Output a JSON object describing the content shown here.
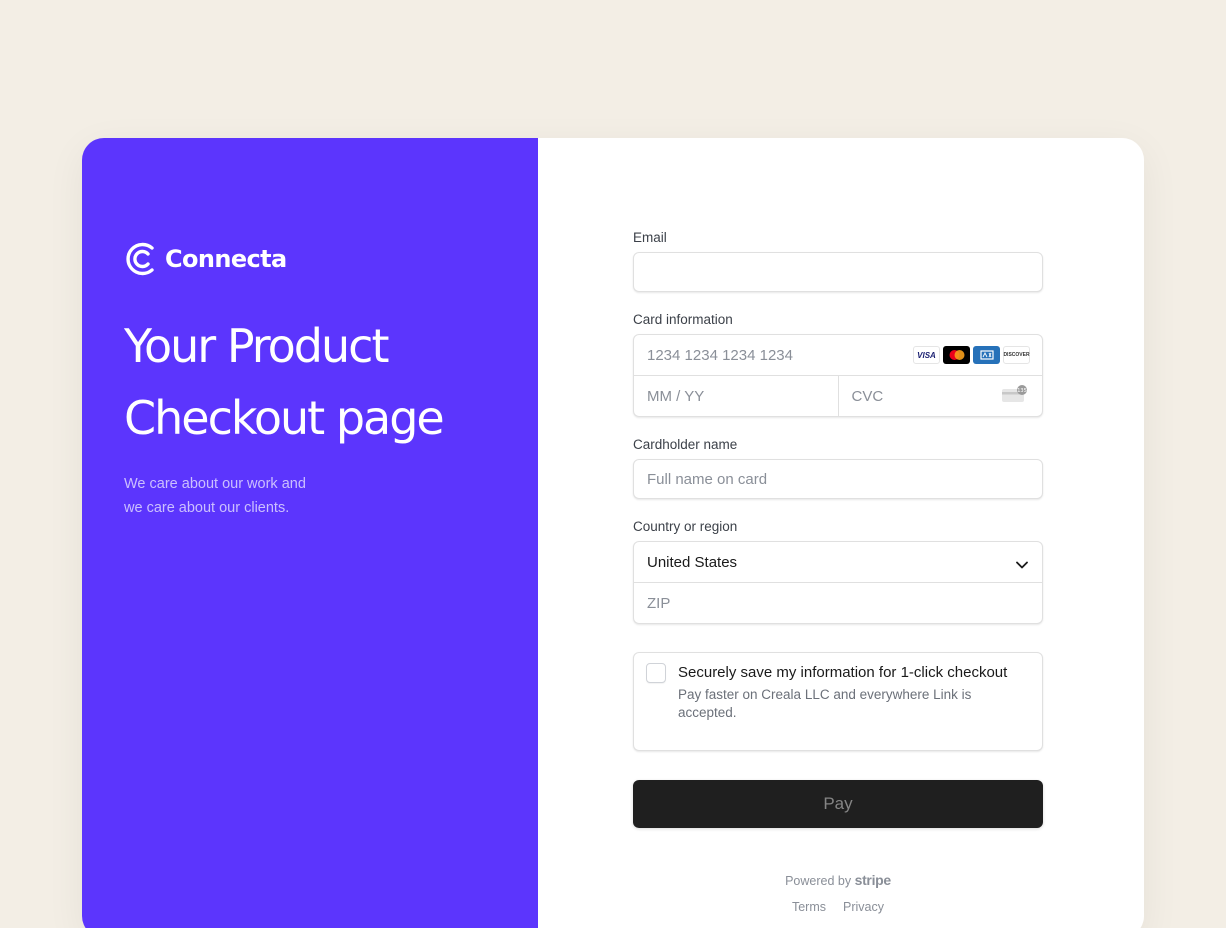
{
  "brand": {
    "name": "Connecta",
    "accent": "#5c35fd"
  },
  "hero": {
    "headline_line1": "Your Product",
    "headline_line2": "Checkout page",
    "tagline_line1": "We care about our work and",
    "tagline_line2": "we care about our clients."
  },
  "form": {
    "email": {
      "label": "Email",
      "value": "",
      "placeholder": ""
    },
    "card": {
      "label": "Card information",
      "number_placeholder": "1234 1234 1234 1234",
      "expiry_placeholder": "MM / YY",
      "cvc_placeholder": "CVC",
      "brands": [
        "VISA",
        "mastercard",
        "amex",
        "DISCOVER"
      ]
    },
    "cardholder": {
      "label": "Cardholder name",
      "placeholder": "Full name on card"
    },
    "country": {
      "label": "Country or region",
      "selected": "United States",
      "zip_placeholder": "ZIP"
    },
    "save": {
      "title": "Securely save my information for 1-click checkout",
      "description": "Pay faster on Creala LLC and everywhere Link is accepted.",
      "checked": false
    },
    "pay_label": "Pay"
  },
  "footer": {
    "powered_by": "Powered by",
    "stripe": "stripe",
    "terms": "Terms",
    "privacy": "Privacy"
  }
}
